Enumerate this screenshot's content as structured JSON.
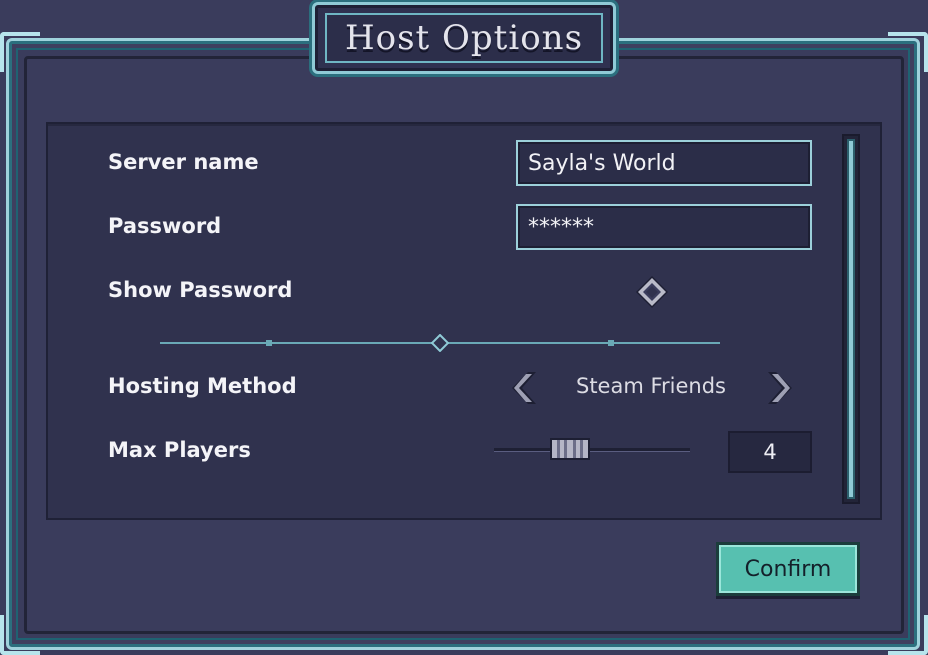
{
  "dialog": {
    "title": "Host Options"
  },
  "fields": {
    "server_name": {
      "label": "Server name",
      "value": "Sayla's World"
    },
    "password": {
      "label": "Password",
      "value": "******"
    },
    "show_password": {
      "label": "Show Password",
      "checked": false
    }
  },
  "hosting_method": {
    "label": "Hosting Method",
    "value": "Steam Friends",
    "prev_icon": "chevron-left-icon",
    "next_icon": "chevron-right-icon"
  },
  "max_players": {
    "label": "Max Players",
    "value": "4",
    "slider_fraction": 0.36
  },
  "actions": {
    "confirm_label": "Confirm"
  },
  "colors": {
    "background": "#3a3c5c",
    "panel": "#30324e",
    "frame_accent": "#9fd2dc",
    "confirm_button": "#57c0b0"
  }
}
